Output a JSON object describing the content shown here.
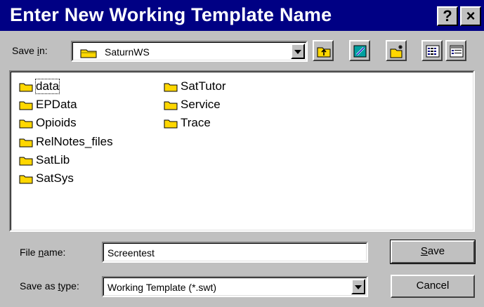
{
  "window": {
    "title": "Enter New Working Template Name",
    "help_button": "?",
    "close_button": "×"
  },
  "save_in": {
    "label_prefix": "Save ",
    "label_accel": "i",
    "label_suffix": "n:",
    "value": "SaturnWS"
  },
  "toolbar": {
    "up_one_level": "up-folder-icon",
    "desktop": "desktop-icon",
    "new_folder": "new-folder-icon",
    "list_view": "list-view-icon",
    "details_view": "details-view-icon"
  },
  "files": {
    "col1": [
      "data",
      "EPData",
      "Opioids",
      "RelNotes_files",
      "SatLib",
      "SatSys"
    ],
    "col2": [
      "SatTutor",
      "Service",
      "Trace"
    ]
  },
  "file_name": {
    "label_prefix": "File ",
    "label_accel": "n",
    "label_suffix": "ame:",
    "value": "Screentest"
  },
  "save_as_type": {
    "label_prefix": "Save as ",
    "label_accel": "t",
    "label_suffix": "ype:",
    "value": "Working Template (*.swt)"
  },
  "buttons": {
    "save_accel": "S",
    "save_rest": "ave",
    "cancel": "Cancel"
  },
  "colors": {
    "titlebar": "#000084",
    "face": "#c0c0c0",
    "folder": "#ffd700"
  }
}
